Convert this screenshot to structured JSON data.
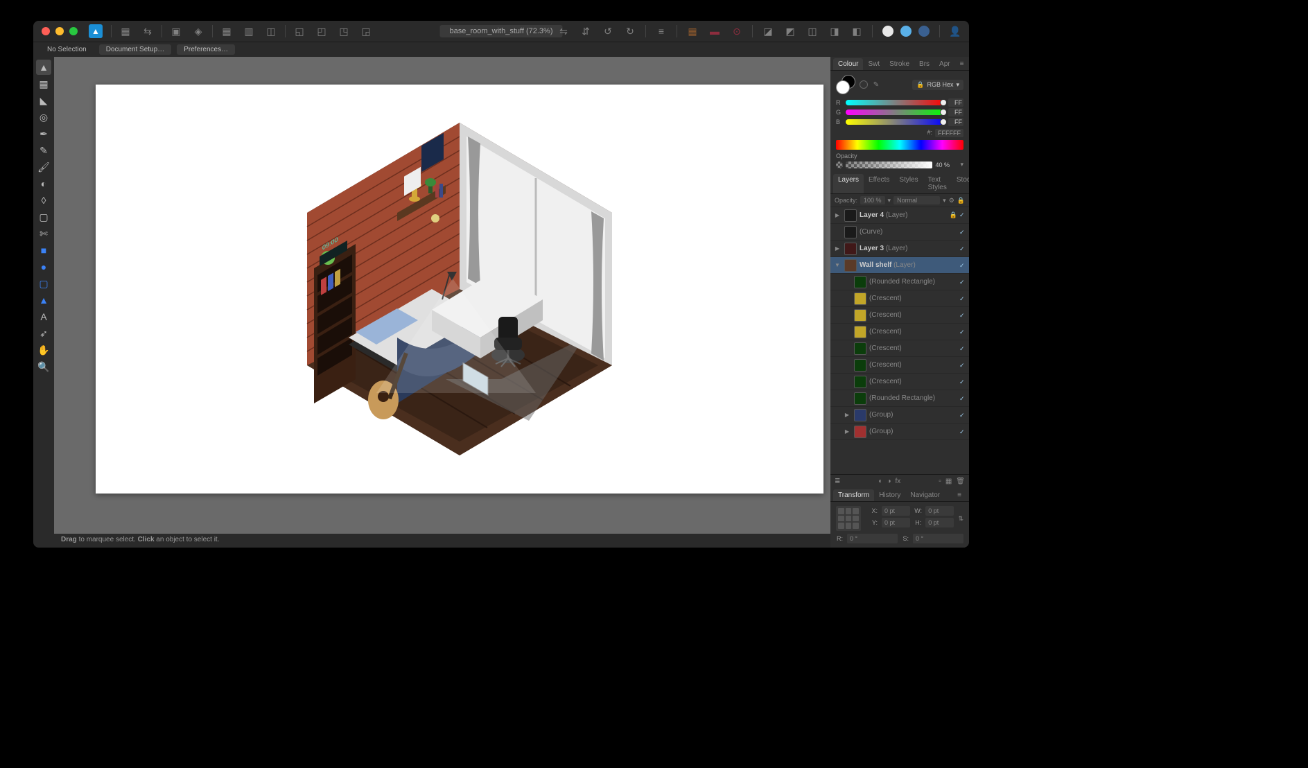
{
  "document_title": "base_room_with_stuff (72.3%)",
  "contextbar": {
    "selection_status": "No Selection",
    "doc_setup": "Document Setup…",
    "prefs": "Preferences…"
  },
  "statusbar": {
    "drag_label": "Drag",
    "drag_desc": " to marquee select. ",
    "click_label": "Click",
    "click_desc": " an object to select it."
  },
  "color_panel": {
    "tabs": [
      "Colour",
      "Swt",
      "Stroke",
      "Brs",
      "Apr"
    ],
    "active_tab": "Colour",
    "mode": "RGB Hex",
    "r": "FF",
    "g": "FF",
    "b": "FF",
    "hex_prefix": "#:",
    "hex": "FFFFFF",
    "opacity_label": "Opacity",
    "opacity_value": "40 %"
  },
  "layers_panel": {
    "tabs": [
      "Layers",
      "Effects",
      "Styles",
      "Text Styles",
      "Stock"
    ],
    "active_tab": "Layers",
    "opacity_label": "Opacity:",
    "opacity_value": "100 %",
    "blend_mode": "Normal",
    "items": [
      {
        "name": "Layer 4",
        "type": "(Layer)",
        "selected": false,
        "expanded": false,
        "disclosure": true,
        "locked": true,
        "indent": 0,
        "thumb": "#1a1a1a"
      },
      {
        "name": "",
        "type": "(Curve)",
        "selected": false,
        "expanded": false,
        "disclosure": false,
        "indent": 0,
        "thumb": "#1a1a1a"
      },
      {
        "name": "Layer 3",
        "type": "(Layer)",
        "selected": false,
        "expanded": false,
        "disclosure": true,
        "indent": 0,
        "thumb": "#401818"
      },
      {
        "name": "Wall shelf",
        "type": "(Layer)",
        "selected": true,
        "expanded": true,
        "disclosure": true,
        "indent": 0,
        "thumb": "#5a3a28"
      },
      {
        "name": "",
        "type": "(Rounded Rectangle)",
        "selected": false,
        "indent": 1,
        "thumb": "#0b3d0b"
      },
      {
        "name": "",
        "type": "(Crescent)",
        "selected": false,
        "indent": 1,
        "thumb": "#c2a628"
      },
      {
        "name": "",
        "type": "(Crescent)",
        "selected": false,
        "indent": 1,
        "thumb": "#c2a628"
      },
      {
        "name": "",
        "type": "(Crescent)",
        "selected": false,
        "indent": 1,
        "thumb": "#c2a628"
      },
      {
        "name": "",
        "type": "(Crescent)",
        "selected": false,
        "indent": 1,
        "thumb": "#0b3d0b"
      },
      {
        "name": "",
        "type": "(Crescent)",
        "selected": false,
        "indent": 1,
        "thumb": "#0b3d0b"
      },
      {
        "name": "",
        "type": "(Crescent)",
        "selected": false,
        "indent": 1,
        "thumb": "#0b3d0b"
      },
      {
        "name": "",
        "type": "(Rounded Rectangle)",
        "selected": false,
        "indent": 1,
        "thumb": "#0b3d0b"
      },
      {
        "name": "",
        "type": "(Group)",
        "selected": false,
        "indent": 1,
        "disclosure": true,
        "thumb": "#2a3a6a"
      },
      {
        "name": "",
        "type": "(Group)",
        "selected": false,
        "indent": 1,
        "disclosure": true,
        "thumb": "#a03030"
      }
    ]
  },
  "transform_panel": {
    "tabs": [
      "Transform",
      "History",
      "Navigator"
    ],
    "active_tab": "Transform",
    "x_label": "X:",
    "x": "0 pt",
    "y_label": "Y:",
    "y": "0 pt",
    "w_label": "W:",
    "w": "0 pt",
    "h_label": "H:",
    "h": "0 pt",
    "r_label": "R:",
    "r": "0 °",
    "s_label": "S:",
    "s": "0 °"
  },
  "tools": [
    {
      "id": "move-tool",
      "glyph": "▲",
      "active": true
    },
    {
      "id": "artboard-tool",
      "glyph": "▦"
    },
    {
      "id": "node-tool",
      "glyph": "◣"
    },
    {
      "id": "point-transform-tool",
      "glyph": "◎"
    },
    {
      "id": "pen-tool",
      "glyph": "✒"
    },
    {
      "id": "pencil-tool",
      "glyph": "✎"
    },
    {
      "id": "vector-brush",
      "glyph": "🖌"
    },
    {
      "id": "fill-tool",
      "glyph": "◐"
    },
    {
      "id": "transparency-tool",
      "glyph": "◊"
    },
    {
      "id": "place-image",
      "glyph": "▢"
    },
    {
      "id": "crop-tool",
      "glyph": "✄"
    },
    {
      "id": "rectangle-tool",
      "glyph": "■",
      "color": "#3b82f6"
    },
    {
      "id": "ellipse-tool",
      "glyph": "●",
      "color": "#3b82f6"
    },
    {
      "id": "rounded-rect-tool",
      "glyph": "▢",
      "color": "#3b82f6"
    },
    {
      "id": "triangle-tool",
      "glyph": "▲",
      "color": "#3b82f6"
    },
    {
      "id": "text-tool",
      "glyph": "A"
    },
    {
      "id": "color-picker",
      "glyph": "➶"
    },
    {
      "id": "view-tool",
      "glyph": "✋",
      "color": "#e0a040"
    },
    {
      "id": "zoom-tool",
      "glyph": "🔍",
      "color": "#5bb0e0"
    }
  ],
  "titlebar_right_icons": [
    "persona-1",
    "persona-2",
    "persona-3",
    "account"
  ]
}
